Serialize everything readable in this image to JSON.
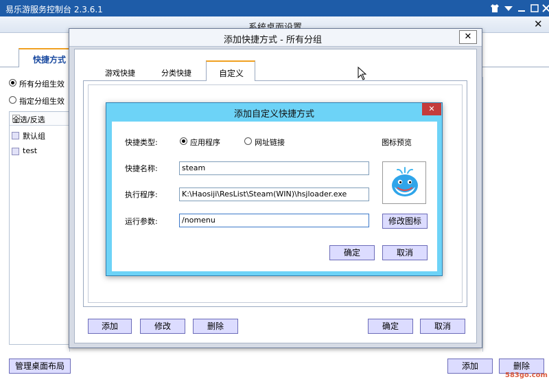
{
  "app": {
    "title": "易乐游服务控制台 2.3.6.1",
    "titlebar_color": "#1e5ca8",
    "icons": [
      "shirt-icon",
      "dropdown-icon",
      "minimize-icon",
      "maximize-icon",
      "close-icon"
    ]
  },
  "settings_window": {
    "title": "系统桌面设置",
    "close_glyph": "✕",
    "tab_label": "快捷方式",
    "options": {
      "all_groups": "所有分组生效",
      "specified_groups": "指定分组生效",
      "selected": "all_groups"
    },
    "group_list": {
      "header": "全选/反选",
      "items": [
        "默认组",
        "test"
      ]
    },
    "manage_layout_button": "管理桌面布局",
    "add_button": "添加",
    "delete_button": "删除"
  },
  "add_shortcut_dialog": {
    "title": "添加快捷方式 - 所有分组",
    "close_glyph": "✕",
    "tabs": [
      {
        "label": "游戏快捷",
        "active": false
      },
      {
        "label": "分类快捷",
        "active": false
      },
      {
        "label": "自定义",
        "active": true
      }
    ],
    "buttons": {
      "add": "添加",
      "edit": "修改",
      "delete": "删除",
      "confirm": "确定",
      "cancel": "取消"
    }
  },
  "custom_shortcut_dialog": {
    "title": "添加自定义快捷方式",
    "close_glyph": "✕",
    "titlebar_color": "#6dd3f7",
    "close_color": "#c43b3b",
    "fields": {
      "type_label": "快捷类型:",
      "type_options": [
        "应用程序",
        "网址链接"
      ],
      "type_selected": "应用程序",
      "name_label": "快捷名称:",
      "name_value": "steam",
      "exec_label": "执行程序:",
      "exec_value": "K:\\Haosiji\\ResList\\Steam(WIN)\\hsjloader.exe",
      "args_label": "运行参数:",
      "args_value": "/nomenu"
    },
    "icon_preview_label": "图标预览",
    "icon_name": "whale-icon",
    "change_icon_button": "修改图标",
    "confirm_button": "确定",
    "cancel_button": "取消"
  },
  "watermark": {
    "text": "583go.com"
  }
}
